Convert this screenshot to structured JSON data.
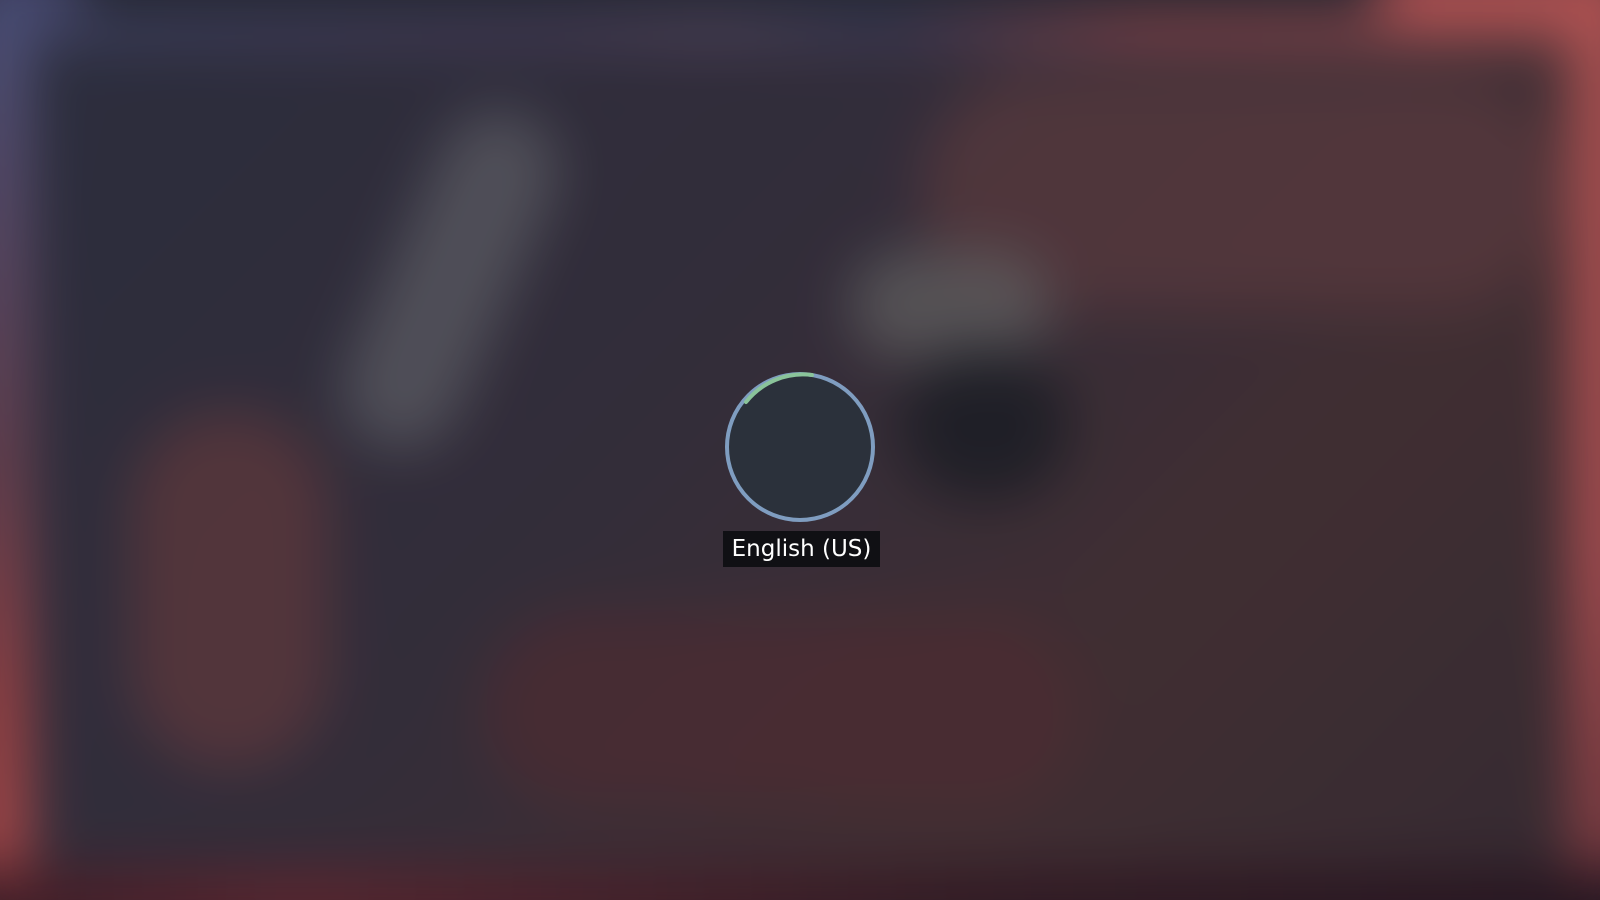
{
  "keyboard_layout_osd": {
    "label": "English (US)",
    "ring_color": "#7f9dc0",
    "arc_color": "#8ac49a",
    "fill_color": "#2b313b"
  },
  "desktop": {
    "background": "blurred"
  }
}
